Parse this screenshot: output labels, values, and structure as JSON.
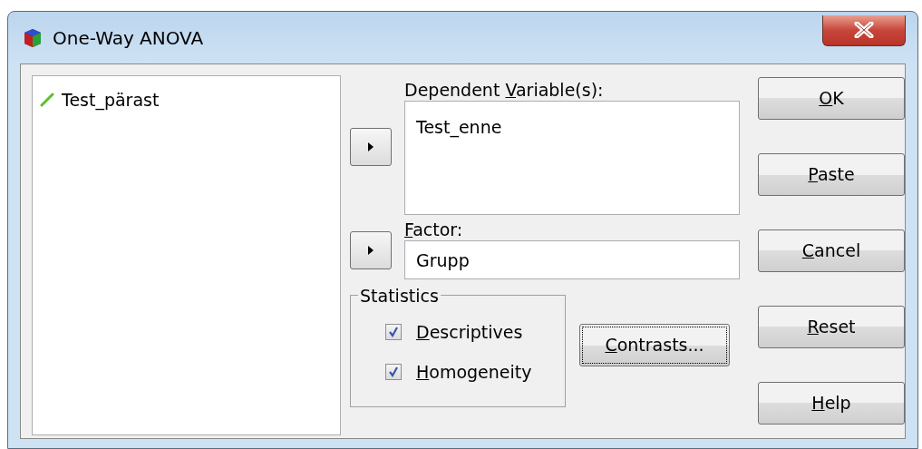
{
  "window": {
    "title": "One-Way ANOVA"
  },
  "source_list": {
    "items": [
      {
        "label": "Test_pärast",
        "selected": false
      }
    ]
  },
  "dependent": {
    "label": {
      "lead": "Dependent ",
      "key": "V",
      "rest": "ariable(s):"
    },
    "items": [
      "Test_enne"
    ]
  },
  "factor": {
    "label": {
      "key": "F",
      "rest": "actor:"
    },
    "value": "Grupp"
  },
  "statistics": {
    "title": "Statistics",
    "options": [
      {
        "label": {
          "key": "D",
          "rest": "escriptives"
        },
        "checked": true
      },
      {
        "label": {
          "key": "H",
          "rest": "omogeneity"
        },
        "checked": true
      }
    ]
  },
  "contrasts_button": {
    "label": {
      "key": "C",
      "rest": "ontrasts..."
    },
    "focused": true
  },
  "buttons": [
    {
      "label": {
        "key": "O",
        "rest": "K"
      },
      "focused": false
    },
    {
      "label": {
        "key": "P",
        "rest": "aste"
      },
      "focused": false
    },
    {
      "label": {
        "key": "C",
        "rest": "ancel"
      },
      "focused": false
    },
    {
      "label": {
        "key": "R",
        "rest": "eset"
      },
      "focused": false
    },
    {
      "label": {
        "key": "H",
        "rest": "elp"
      },
      "focused": false
    }
  ]
}
